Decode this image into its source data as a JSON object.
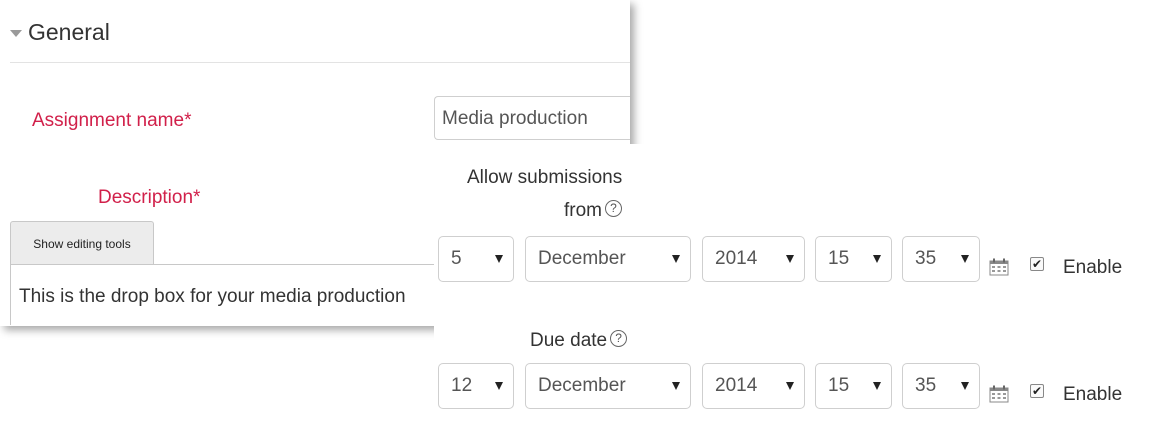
{
  "general": {
    "title": "General",
    "assignment_name_label": "Assignment name*",
    "assignment_name_value": "Media production",
    "description_label": "Description*",
    "editor_tab_label": "Show editing tools",
    "editor_text": "This is the drop box for your media production"
  },
  "dates": {
    "allow_label_line1": "Allow submissions",
    "allow_label_line2": "from",
    "due_label": "Due date",
    "help_glyph": "?",
    "allow": {
      "day": "5",
      "month": "December",
      "year": "2014",
      "hour": "15",
      "minute": "35",
      "enable_label": "Enable",
      "enabled": true
    },
    "due": {
      "day": "12",
      "month": "December",
      "year": "2014",
      "hour": "15",
      "minute": "35",
      "enable_label": "Enable",
      "enabled": true
    }
  },
  "colors": {
    "required_label": "#d1204a",
    "border": "#cfcfcf"
  },
  "icons": [
    "collapse-triangle-icon",
    "help-icon",
    "calendar-icon",
    "checkbox-checked-icon",
    "dropdown-caret-icon"
  ]
}
